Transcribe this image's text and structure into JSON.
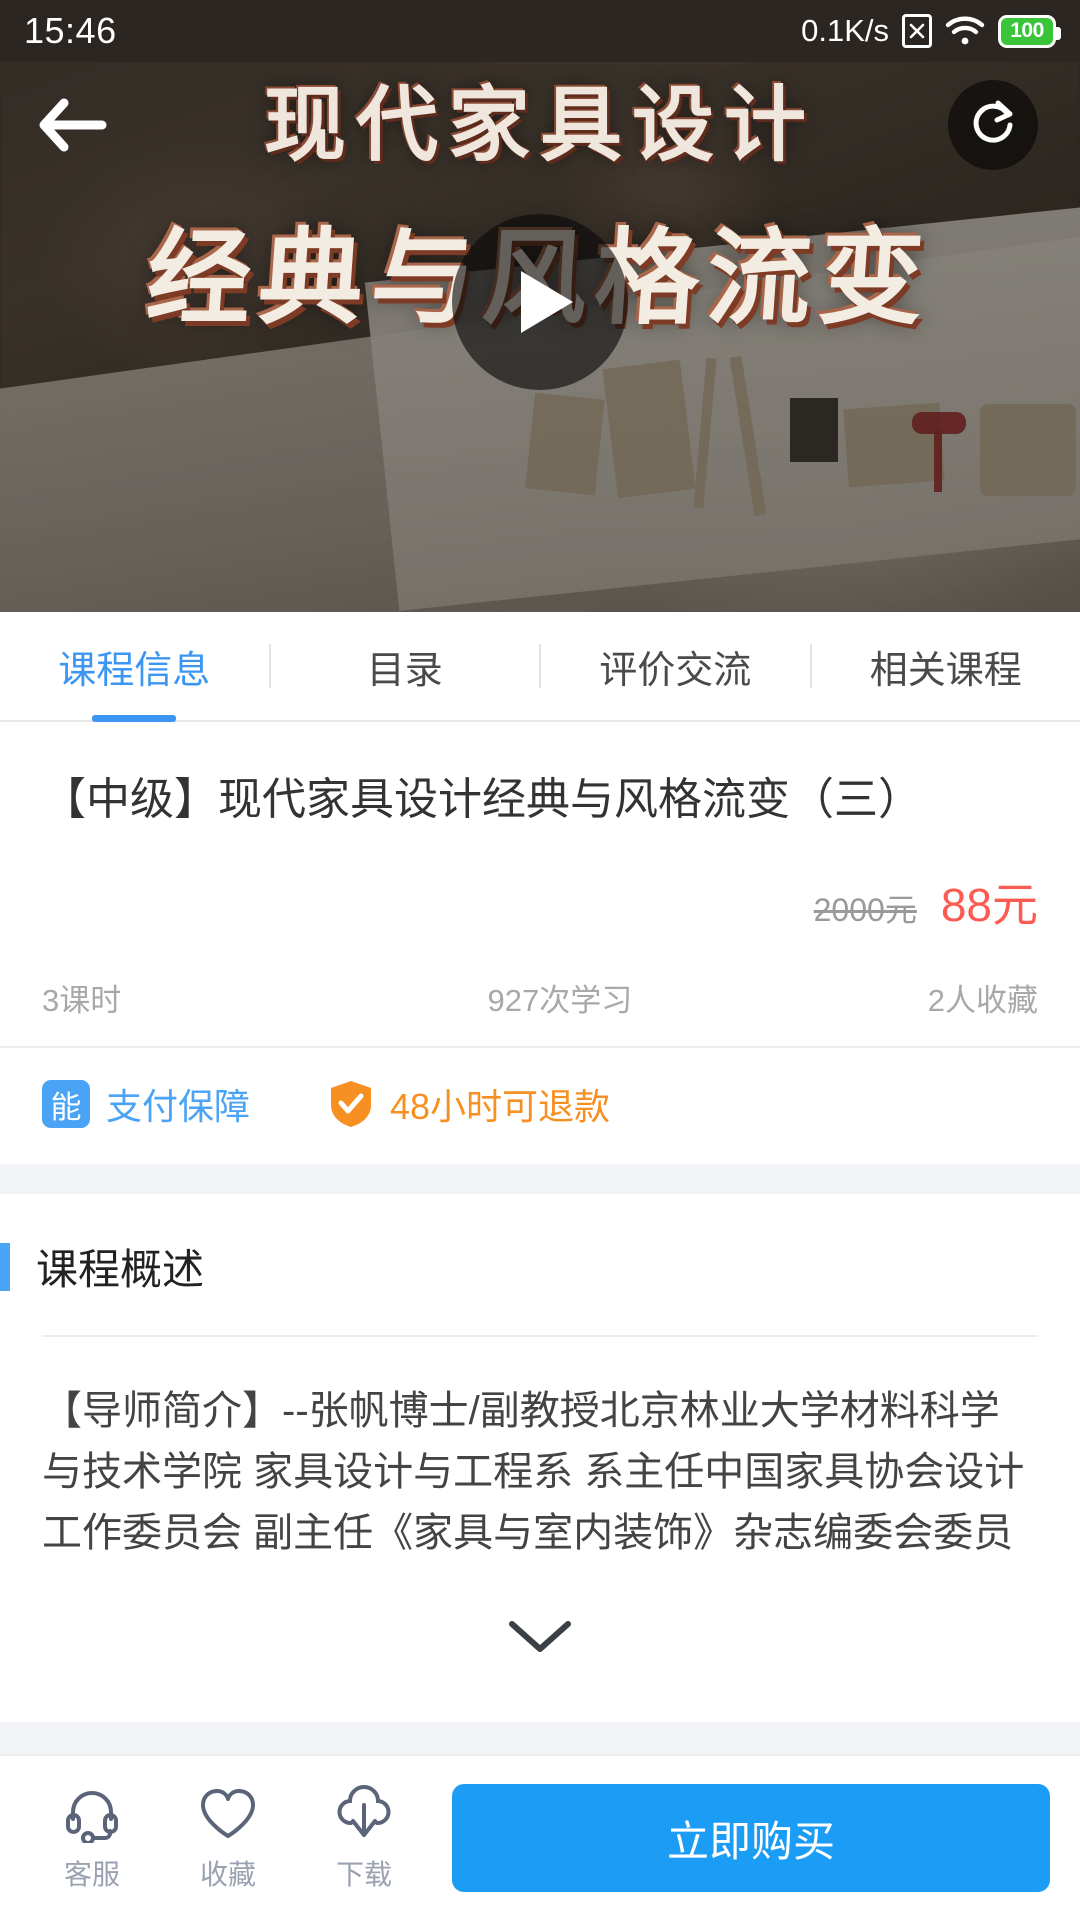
{
  "status_bar": {
    "time": "15:46",
    "network_speed": "0.1K/s",
    "sim_icon": "sim-card-x-icon",
    "wifi_icon": "wifi-icon",
    "battery_level": "100"
  },
  "hero": {
    "title_line1": "现代家具设计",
    "title_line2": "经典与风格流变",
    "back_icon": "back-arrow-icon",
    "share_icon": "share-refresh-icon",
    "play_icon": "play-icon"
  },
  "tabs": [
    {
      "label": "课程信息",
      "active": true
    },
    {
      "label": "目录",
      "active": false
    },
    {
      "label": "评价交流",
      "active": false
    },
    {
      "label": "相关课程",
      "active": false
    }
  ],
  "course": {
    "title": "【中级】现代家具设计经典与风格流变（三）",
    "price_original": "2000元",
    "price_current": "88元",
    "stats": {
      "lessons": "3课时",
      "learners": "927次学习",
      "favorites": "2人收藏"
    },
    "badges": [
      {
        "icon_label": "能",
        "text": "支付保障",
        "color": "#4aa3f5"
      },
      {
        "icon_label": "shield-check-icon",
        "text": "48小时可退款",
        "color": "#f79022"
      }
    ]
  },
  "overview": {
    "section_title": "课程概述",
    "body": "【导师简介】--张帆博士/副教授北京林业大学材料科学与技术学院 家具设计与工程系 系主任中国家具协会设计工作委员会 副主任《家具与室内装饰》杂志编委会委员",
    "expand_icon": "chevron-down-icon"
  },
  "bottom_bar": {
    "items": [
      {
        "icon": "headset-icon",
        "label": "客服"
      },
      {
        "icon": "heart-icon",
        "label": "收藏"
      },
      {
        "icon": "cloud-download-icon",
        "label": "下载"
      }
    ],
    "buy_label": "立即购买",
    "buy_color": "#1c9df5"
  }
}
